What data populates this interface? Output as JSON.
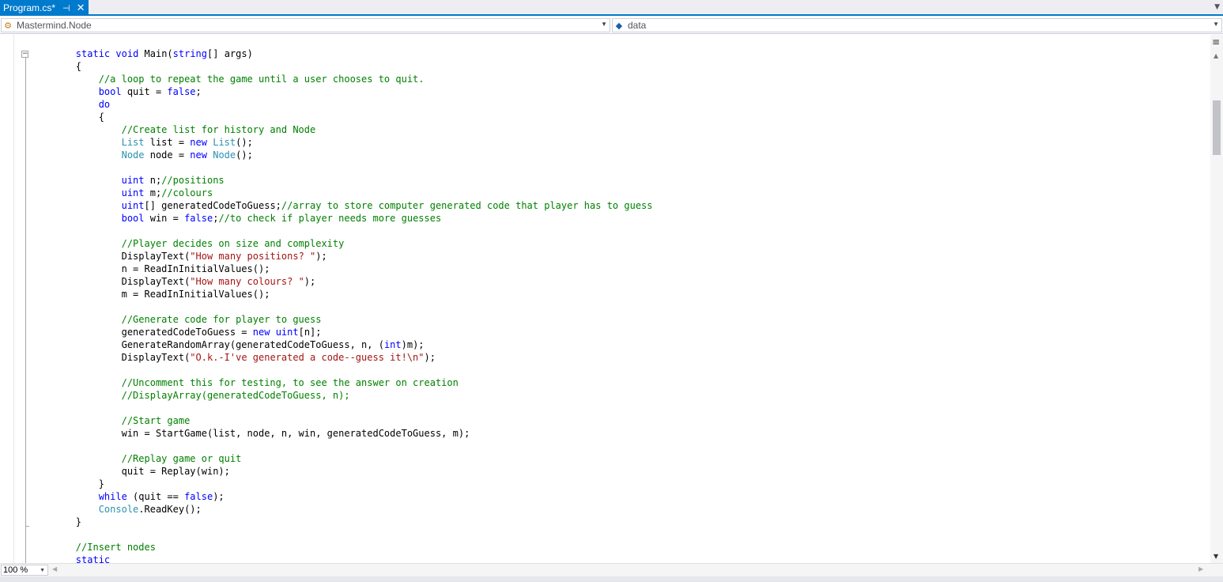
{
  "tab": {
    "title": "Program.cs*",
    "pin_icon": "pin-icon",
    "close_icon": "close-icon",
    "accent": "#007acc"
  },
  "nav": {
    "type_combo": "Mastermind.Node",
    "member_combo": "data"
  },
  "zoom": "100 %",
  "code_lines": [
    [
      [
        "k",
        "static"
      ],
      [
        "p",
        " "
      ],
      [
        "k",
        "void"
      ],
      [
        "p",
        " Main("
      ],
      [
        "k",
        "string"
      ],
      [
        "p",
        "[] args)"
      ]
    ],
    [
      [
        "p",
        "{"
      ]
    ],
    [
      [
        "p",
        "    "
      ],
      [
        "c",
        "//a loop to repeat the game until a user chooses to quit."
      ]
    ],
    [
      [
        "p",
        "    "
      ],
      [
        "k",
        "bool"
      ],
      [
        "p",
        " quit = "
      ],
      [
        "k",
        "false"
      ],
      [
        "p",
        ";"
      ]
    ],
    [
      [
        "p",
        "    "
      ],
      [
        "k",
        "do"
      ]
    ],
    [
      [
        "p",
        "    {"
      ]
    ],
    [
      [
        "p",
        "        "
      ],
      [
        "c",
        "//Create list for history and Node"
      ]
    ],
    [
      [
        "p",
        "        "
      ],
      [
        "t",
        "List"
      ],
      [
        "p",
        " list = "
      ],
      [
        "k",
        "new"
      ],
      [
        "p",
        " "
      ],
      [
        "t",
        "List"
      ],
      [
        "p",
        "();"
      ]
    ],
    [
      [
        "p",
        "        "
      ],
      [
        "t",
        "Node"
      ],
      [
        "p",
        " node = "
      ],
      [
        "k",
        "new"
      ],
      [
        "p",
        " "
      ],
      [
        "t",
        "Node"
      ],
      [
        "p",
        "();"
      ]
    ],
    [],
    [
      [
        "p",
        "        "
      ],
      [
        "k",
        "uint"
      ],
      [
        "p",
        " n;"
      ],
      [
        "c",
        "//positions"
      ]
    ],
    [
      [
        "p",
        "        "
      ],
      [
        "k",
        "uint"
      ],
      [
        "p",
        " m;"
      ],
      [
        "c",
        "//colours"
      ]
    ],
    [
      [
        "p",
        "        "
      ],
      [
        "k",
        "uint"
      ],
      [
        "p",
        "[] generatedCodeToGuess;"
      ],
      [
        "c",
        "//array to store computer generated code that player has to guess"
      ]
    ],
    [
      [
        "p",
        "        "
      ],
      [
        "k",
        "bool"
      ],
      [
        "p",
        " win = "
      ],
      [
        "k",
        "false"
      ],
      [
        "p",
        ";"
      ],
      [
        "c",
        "//to check if player needs more guesses"
      ]
    ],
    [],
    [
      [
        "p",
        "        "
      ],
      [
        "c",
        "//Player decides on size and complexity"
      ]
    ],
    [
      [
        "p",
        "        DisplayText("
      ],
      [
        "s",
        "\"How many positions? \""
      ],
      [
        "p",
        ");"
      ]
    ],
    [
      [
        "p",
        "        n = ReadInInitialValues();"
      ]
    ],
    [
      [
        "p",
        "        DisplayText("
      ],
      [
        "s",
        "\"How many colours? \""
      ],
      [
        "p",
        ");"
      ]
    ],
    [
      [
        "p",
        "        m = ReadInInitialValues();"
      ]
    ],
    [],
    [
      [
        "p",
        "        "
      ],
      [
        "c",
        "//Generate code for player to guess"
      ]
    ],
    [
      [
        "p",
        "        generatedCodeToGuess = "
      ],
      [
        "k",
        "new"
      ],
      [
        "p",
        " "
      ],
      [
        "k",
        "uint"
      ],
      [
        "p",
        "[n];"
      ]
    ],
    [
      [
        "p",
        "        GenerateRandomArray(generatedCodeToGuess, n, ("
      ],
      [
        "k",
        "int"
      ],
      [
        "p",
        ")m);"
      ]
    ],
    [
      [
        "p",
        "        DisplayText("
      ],
      [
        "s",
        "\"O.k.-I've generated a code--guess it!\\n\""
      ],
      [
        "p",
        ");"
      ]
    ],
    [],
    [
      [
        "p",
        "        "
      ],
      [
        "c",
        "//Uncomment this for testing, to see the answer on creation"
      ]
    ],
    [
      [
        "p",
        "        "
      ],
      [
        "c",
        "//DisplayArray(generatedCodeToGuess, n);"
      ]
    ],
    [],
    [
      [
        "p",
        "        "
      ],
      [
        "c",
        "//Start game"
      ]
    ],
    [
      [
        "p",
        "        win = StartGame(list, node, n, win, generatedCodeToGuess, m);"
      ]
    ],
    [],
    [
      [
        "p",
        "        "
      ],
      [
        "c",
        "//Replay game or quit"
      ]
    ],
    [
      [
        "p",
        "        quit = Replay(win);"
      ]
    ],
    [
      [
        "p",
        "    }"
      ]
    ],
    [
      [
        "p",
        "    "
      ],
      [
        "k",
        "while"
      ],
      [
        "p",
        " (quit == "
      ],
      [
        "k",
        "false"
      ],
      [
        "p",
        ");"
      ]
    ],
    [
      [
        "p",
        "    "
      ],
      [
        "t",
        "Console"
      ],
      [
        "p",
        ".ReadKey();"
      ]
    ],
    [
      [
        "p",
        "}"
      ]
    ],
    [],
    [
      [
        "c",
        "//Insert nodes"
      ]
    ],
    [
      [
        "k",
        "static"
      ]
    ]
  ],
  "colors": {
    "keyword": "#0000ff",
    "type": "#2b91af",
    "comment": "#008000",
    "string": "#a31515",
    "text": "#000000"
  }
}
